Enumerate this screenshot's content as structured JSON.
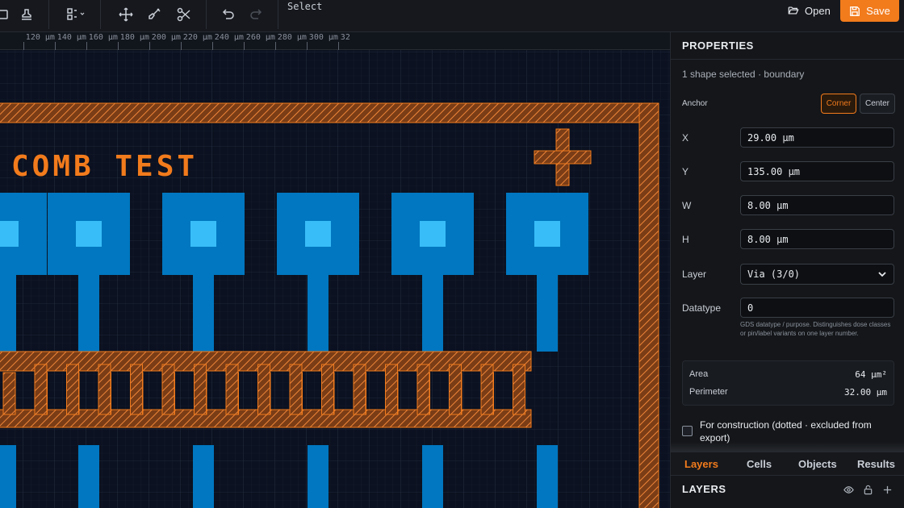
{
  "toolbar": {
    "mode_label": "Select",
    "open_label": "Open",
    "save_label": "Save",
    "colors": {
      "accent": "#f27b1c"
    }
  },
  "ruler": {
    "unit": "µm",
    "ticks": [
      "120 µm",
      "140 µm",
      "160 µm",
      "180 µm",
      "200 µm",
      "220 µm",
      "240 µm",
      "260 µm",
      "280 µm",
      "300 µm",
      "32"
    ]
  },
  "layout": {
    "label_text": "COMB TEST",
    "colors": {
      "metal": "#0077c0",
      "via": "#38bdf8",
      "boundary": "#f27b1c",
      "background": "#0b1120"
    }
  },
  "properties": {
    "title": "PROPERTIES",
    "selection_info": "1 shape selected · boundary",
    "anchor": {
      "label": "Anchor",
      "options": [
        "Corner",
        "Center"
      ],
      "selected": "Corner"
    },
    "x": {
      "label": "X",
      "value": "29.00 µm"
    },
    "y": {
      "label": "Y",
      "value": "135.00 µm"
    },
    "w": {
      "label": "W",
      "value": "8.00 µm"
    },
    "h": {
      "label": "H",
      "value": "8.00 µm"
    },
    "layer": {
      "label": "Layer",
      "value": "Via (3/0)"
    },
    "datatype": {
      "label": "Datatype",
      "value": "0",
      "hint": "GDS datatype / purpose. Distinguishes dose classes or pin/label variants on one layer number."
    },
    "stats": {
      "area_label": "Area",
      "area_value": "64 µm²",
      "perimeter_label": "Perimeter",
      "perimeter_value": "32.00 µm"
    },
    "construction": {
      "label": "For construction (dotted · excluded from export)",
      "checked": false
    }
  },
  "tabs": [
    "Layers",
    "Cells",
    "Objects",
    "Results"
  ],
  "active_tab": "Layers",
  "layers": {
    "title": "LAYERS"
  }
}
